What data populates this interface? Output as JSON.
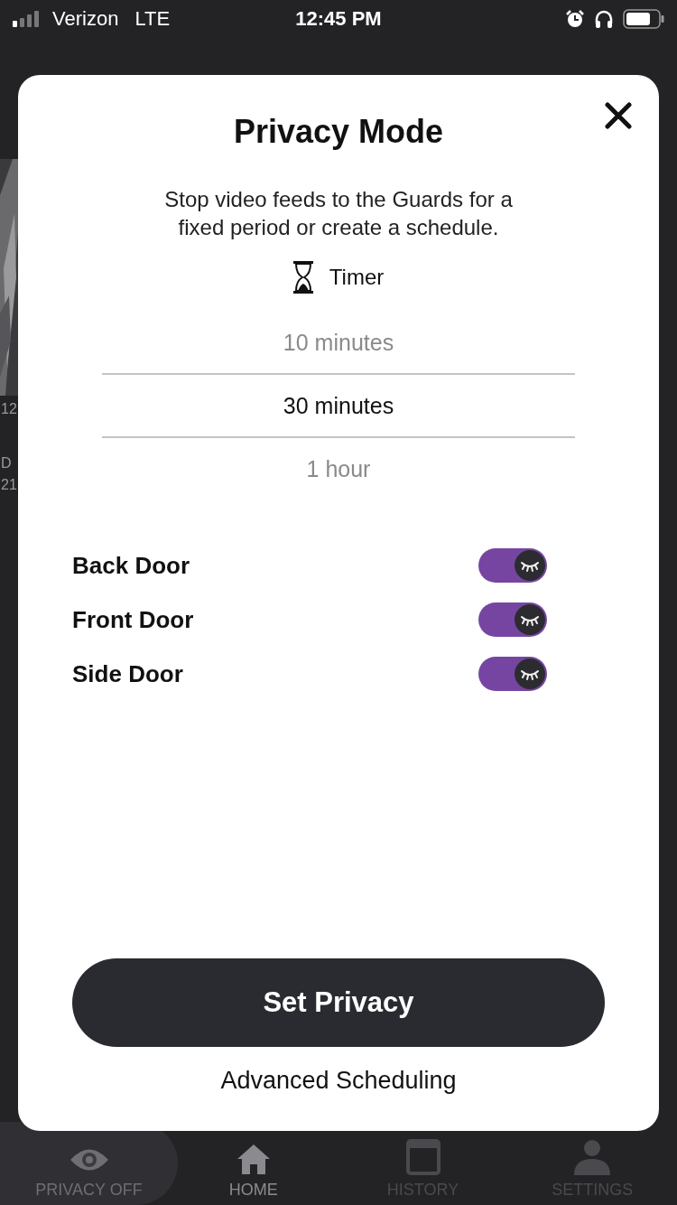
{
  "status_bar": {
    "carrier": "Verizon",
    "network": "LTE",
    "time": "12:45 PM"
  },
  "background": {
    "texts": [
      "12",
      "D",
      "21"
    ]
  },
  "modal": {
    "title": "Privacy Mode",
    "description": "Stop video feeds to the Guards for a fixed period or create a schedule.",
    "mode_label": "Timer",
    "picker": [
      {
        "label": "10 minutes",
        "selected": false
      },
      {
        "label": "30 minutes",
        "selected": true
      },
      {
        "label": "1 hour",
        "selected": false
      }
    ],
    "cameras": [
      {
        "name": "Back Door",
        "on": true
      },
      {
        "name": "Front Door",
        "on": true
      },
      {
        "name": "Side Door",
        "on": true
      }
    ],
    "primary_button": "Set Privacy",
    "link": "Advanced Scheduling"
  },
  "tab_bar": [
    {
      "label": "PRIVACY OFF",
      "kind": "privacy",
      "selected": false
    },
    {
      "label": "HOME",
      "kind": "home",
      "selected": true
    },
    {
      "label": "HISTORY",
      "kind": "history",
      "selected": false
    },
    {
      "label": "SETTINGS",
      "kind": "settings",
      "selected": false
    }
  ]
}
